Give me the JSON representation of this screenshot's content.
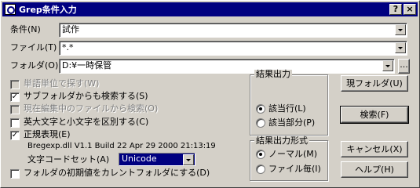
{
  "window": {
    "title": "Grep条件入力",
    "help_btn": "?",
    "close_btn": "×"
  },
  "condition": {
    "label": "条件(N)",
    "value": "試作"
  },
  "file": {
    "label": "ファイル(T)",
    "value": "*.*"
  },
  "folder": {
    "label": "フォルダ(O)",
    "value": "D:¥一時保管",
    "browse": "..."
  },
  "buttons": {
    "current_folder": "現フォルダ(U)",
    "search": "検索(F)",
    "cancel": "キャンセル(X)",
    "help": "ヘルプ(H)"
  },
  "options": {
    "word_unit": "単語単位で探す(W)",
    "subfolder": "サブフォルダからも検索する(S)",
    "current_file": "現在編集中のファイルから検索(O)",
    "case": "英大文字と小文字を区別する(C)",
    "regex": "正規表現(E)",
    "regex_lib": "Bregexp.dll V1.1  Build 22 Apr 29 2000 21:13:19",
    "charset_label": "文字コードセット(A)",
    "charset_value": "Unicode",
    "init_folder": "フォルダの初期値をカレントフォルダにする(D)"
  },
  "result_output": {
    "title": "結果出力",
    "opt1": "該当行(L)",
    "opt2": "該当部分(P)"
  },
  "result_format": {
    "title": "結果出力形式",
    "opt1": "ノーマル(M)",
    "opt2": "ファイル毎(I)"
  }
}
